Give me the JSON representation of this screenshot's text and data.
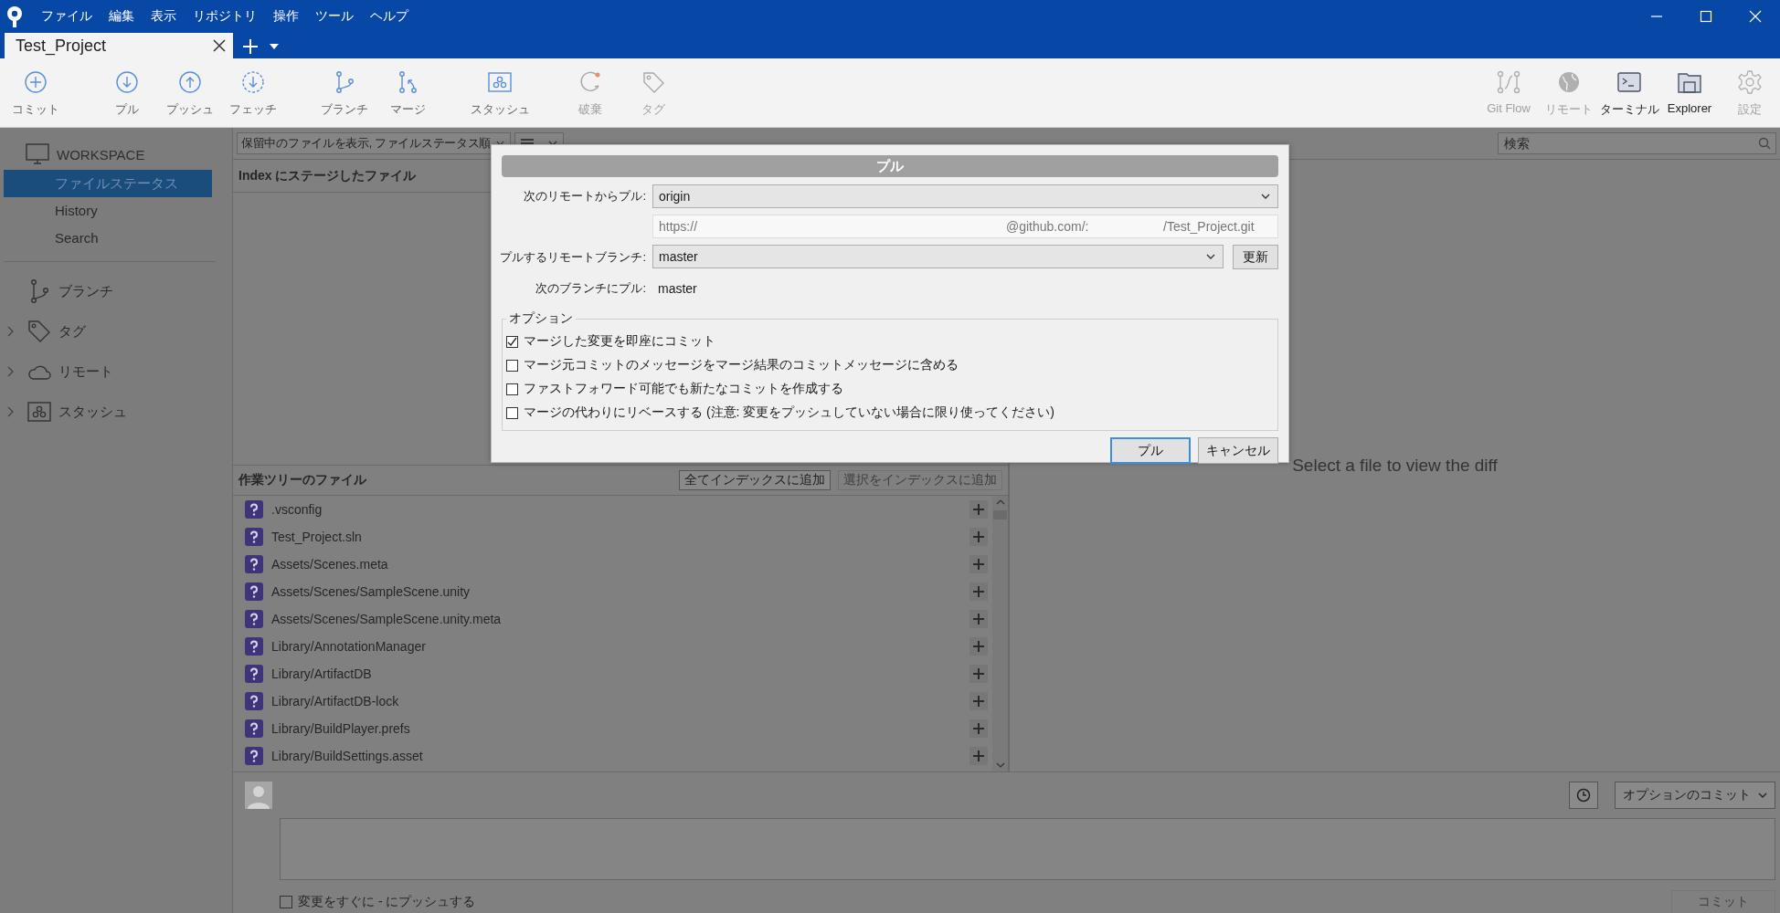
{
  "menu": [
    "ファイル",
    "編集",
    "表示",
    "リポジトリ",
    "操作",
    "ツール",
    "ヘルプ"
  ],
  "tabs": [
    {
      "label": "Test_Project",
      "selected": true
    }
  ],
  "toolbar": {
    "left": [
      {
        "label": "コミット",
        "disabled": false
      },
      {
        "label": "プル",
        "disabled": false
      },
      {
        "label": "プッシュ",
        "disabled": false
      },
      {
        "label": "フェッチ",
        "disabled": false
      },
      {
        "label": "ブランチ",
        "disabled": false
      },
      {
        "label": "マージ",
        "disabled": false
      },
      {
        "label": "スタッシュ",
        "disabled": false
      },
      {
        "label": "破棄",
        "disabled": true
      },
      {
        "label": "タグ",
        "disabled": true
      }
    ],
    "right": [
      {
        "label": "Git Flow",
        "disabled": true
      },
      {
        "label": "リモート",
        "disabled": true
      },
      {
        "label": "ターミナル",
        "disabled": false
      },
      {
        "label": "Explorer",
        "disabled": false
      },
      {
        "label": "設定",
        "disabled": true
      }
    ]
  },
  "sidebar": {
    "workspace": {
      "label": "WORKSPACE",
      "items": [
        {
          "label": "ファイルステータス",
          "selected": true
        },
        {
          "label": "History",
          "selected": false
        },
        {
          "label": "Search",
          "selected": false
        }
      ]
    },
    "sections": [
      {
        "label": "ブランチ"
      },
      {
        "label": "タグ",
        "expanded": false
      },
      {
        "label": "リモート",
        "expanded": false
      },
      {
        "label": "スタッシュ",
        "expanded": false
      }
    ]
  },
  "file_status": {
    "filter": "保留中のファイルを表示, ファイルステータス順",
    "search": {
      "placeholder": "検索"
    },
    "staged_header": "Index にステージしたファイル",
    "working_header": "作業ツリーのファイル",
    "buttons": [
      {
        "label": "全てインデックスに追加",
        "disabled": false
      },
      {
        "label": "選択をインデックスに追加",
        "disabled": true
      }
    ],
    "files": [
      ".vsconfig",
      "Test_Project.sln",
      "Assets/Scenes.meta",
      "Assets/Scenes/SampleScene.unity",
      "Assets/Scenes/SampleScene.unity.meta",
      "Library/AnnotationManager",
      "Library/ArtifactDB",
      "Library/ArtifactDB-lock",
      "Library/BuildPlayer.prefs",
      "Library/BuildSettings.asset"
    ]
  },
  "diff": {
    "placeholder": "Select a file to view the diff"
  },
  "commit": {
    "push_label": "変更をすぐに - にプッシュする",
    "push_checked": false,
    "options": "オプションのコミット",
    "button": "コミット",
    "button_disabled": true
  },
  "dialog": {
    "title": "プル",
    "remote_label": "次のリモートからプル:",
    "remote": "origin",
    "url_parts": [
      "https://",
      "@github.com/:",
      "/Test_Project.git"
    ],
    "branch_label": "プルするリモートブランチ:",
    "branch": "master",
    "refresh": "更新",
    "local_label": "次のブランチにプル:",
    "local": "master",
    "legend": "オプション",
    "options": [
      {
        "label": "マージした変更を即座にコミット",
        "checked": true
      },
      {
        "label": "マージ元コミットのメッセージをマージ結果のコミットメッセージに含める",
        "checked": false
      },
      {
        "label": "ファストフォワード可能でも新たなコミットを作成する",
        "checked": false
      },
      {
        "label": "マージの代わりにリベースする (注意: 変更をプッシュしていない場合に限り使ってください)",
        "checked": false
      }
    ],
    "buttons": [
      {
        "label": "プル",
        "default": true
      },
      {
        "label": "キャンセル",
        "default": false
      }
    ]
  }
}
